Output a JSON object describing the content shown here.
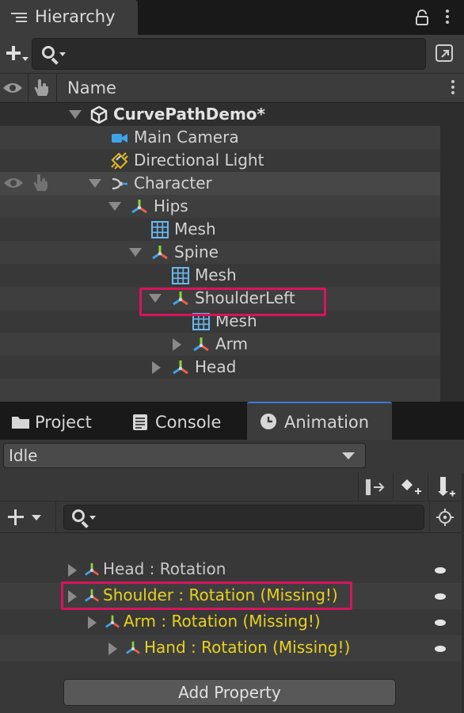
{
  "hierarchy": {
    "tab_title": "Hierarchy",
    "column_name": "Name",
    "search_placeholder": "",
    "items": [
      {
        "label": "CurvePathDemo*",
        "icon": "unity-scene-icon"
      },
      {
        "label": "Main Camera",
        "icon": "camera-icon"
      },
      {
        "label": "Directional Light",
        "icon": "directional-light-icon"
      },
      {
        "label": "Character",
        "icon": "character-transform-icon"
      },
      {
        "label": "Hips",
        "icon": "bone-transform-icon"
      },
      {
        "label": "Mesh",
        "icon": "mesh-grid-icon"
      },
      {
        "label": "Spine",
        "icon": "bone-transform-icon"
      },
      {
        "label": "Mesh",
        "icon": "mesh-grid-icon"
      },
      {
        "label": "ShoulderLeft",
        "icon": "bone-transform-icon",
        "highlighted": true
      },
      {
        "label": "Mesh",
        "icon": "mesh-grid-icon"
      },
      {
        "label": "Arm",
        "icon": "bone-transform-icon"
      },
      {
        "label": "Head",
        "icon": "bone-transform-icon"
      }
    ]
  },
  "bottom_tabs": [
    {
      "label": "Project",
      "icon": "folder-icon"
    },
    {
      "label": "Console",
      "icon": "console-icon"
    },
    {
      "label": "Animation",
      "icon": "clock-icon",
      "active": true
    }
  ],
  "animation": {
    "clip": "Idle",
    "search_placeholder": "",
    "properties": [
      {
        "label": "Head : Rotation",
        "missing": false
      },
      {
        "label": "Shoulder : Rotation (Missing!)",
        "missing": true,
        "highlighted": true
      },
      {
        "label": "Arm : Rotation (Missing!)",
        "missing": true
      },
      {
        "label": "Hand : Rotation (Missing!)",
        "missing": true
      }
    ],
    "add_property_label": "Add Property"
  },
  "colors": {
    "highlight": "#d8145c",
    "missing_text": "#e8d21e",
    "active_tab_accent": "#3a7ad8"
  }
}
